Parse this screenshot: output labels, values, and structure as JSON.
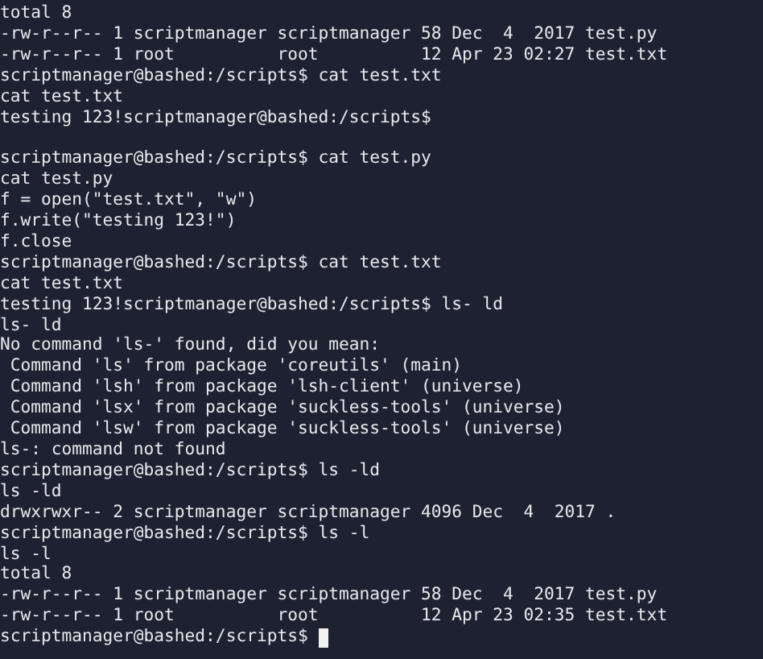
{
  "terminal": {
    "blocks": [
      [
        "total 8",
        "-rw-r--r-- 1 scriptmanager scriptmanager 58 Dec  4  2017 test.py",
        "-rw-r--r-- 1 root          root          12 Apr 23 02:27 test.txt",
        "scriptmanager@bashed:/scripts$ cat test.txt",
        "cat test.txt",
        "testing 123!scriptmanager@bashed:/scripts$"
      ],
      [
        "scriptmanager@bashed:/scripts$ cat test.py",
        "cat test.py",
        "f = open(\"test.txt\", \"w\")",
        "f.write(\"testing 123!\")",
        "f.close",
        "scriptmanager@bashed:/scripts$ cat test.txt",
        "cat test.txt",
        "testing 123!scriptmanager@bashed:/scripts$ ls- ld",
        "ls- ld",
        "No command 'ls-' found, did you mean:",
        " Command 'ls' from package 'coreutils' (main)",
        " Command 'lsh' from package 'lsh-client' (universe)",
        " Command 'lsx' from package 'suckless-tools' (universe)",
        " Command 'lsw' from package 'suckless-tools' (universe)",
        "ls-: command not found",
        "scriptmanager@bashed:/scripts$ ls -ld",
        "ls -ld",
        "drwxrwxr-- 2 scriptmanager scriptmanager 4096 Dec  4  2017 .",
        "scriptmanager@bashed:/scripts$ ls -l",
        "ls -l",
        "total 8",
        "-rw-r--r-- 1 scriptmanager scriptmanager 58 Dec  4  2017 test.py",
        "-rw-r--r-- 1 root          root          12 Apr 23 02:35 test.txt"
      ]
    ],
    "prompt": {
      "text": "scriptmanager@bashed:/scripts$",
      "cursor": true
    }
  }
}
